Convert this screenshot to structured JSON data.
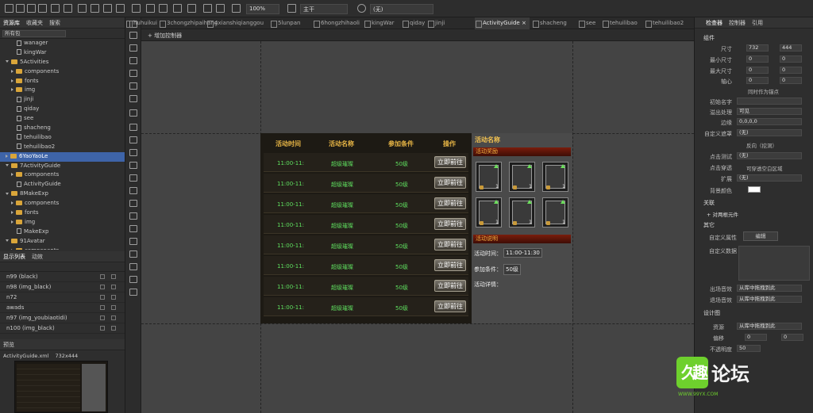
{
  "toolbar": {
    "zoom": "100%",
    "scene": "主干",
    "device": "(无)"
  },
  "left_panel": {
    "tabs": [
      "资源库",
      "收藏夹",
      "搜索"
    ],
    "filter": "所有包",
    "tree": [
      {
        "label": "wanager",
        "type": "file",
        "indent": 3
      },
      {
        "label": "kingWar",
        "type": "file",
        "indent": 3
      },
      {
        "label": "5Activities",
        "type": "folder",
        "indent": 1,
        "open": true
      },
      {
        "label": "components",
        "type": "folder",
        "indent": 2
      },
      {
        "label": "fonts",
        "type": "folder",
        "indent": 2
      },
      {
        "label": "img",
        "type": "folder",
        "indent": 2
      },
      {
        "label": "jinji",
        "type": "file",
        "indent": 3
      },
      {
        "label": "qiday",
        "type": "file",
        "indent": 3
      },
      {
        "label": "see",
        "type": "file",
        "indent": 3
      },
      {
        "label": "shacheng",
        "type": "file",
        "indent": 3
      },
      {
        "label": "tehuilibao",
        "type": "file",
        "indent": 3
      },
      {
        "label": "tehuilibao2",
        "type": "file",
        "indent": 3
      },
      {
        "label": "6YaoYaoLe",
        "type": "folder",
        "indent": 1,
        "selected": true
      },
      {
        "label": "7ActivityGuide",
        "type": "folder",
        "indent": 1,
        "open": true
      },
      {
        "label": "components",
        "type": "folder",
        "indent": 2
      },
      {
        "label": "ActivityGuide",
        "type": "file",
        "indent": 3
      },
      {
        "label": "8MakeExp",
        "type": "folder",
        "indent": 1,
        "open": true
      },
      {
        "label": "components",
        "type": "folder",
        "indent": 2
      },
      {
        "label": "fonts",
        "type": "folder",
        "indent": 2
      },
      {
        "label": "img",
        "type": "folder",
        "indent": 2
      },
      {
        "label": "MakeExp",
        "type": "file",
        "indent": 3
      },
      {
        "label": "91Avatar",
        "type": "folder",
        "indent": 1,
        "open": true
      },
      {
        "label": "components",
        "type": "folder",
        "indent": 2
      }
    ],
    "display_tabs": [
      "显示列表",
      "动效"
    ],
    "display_rows": [
      "n99 (black)",
      "n98 (img_black)",
      "n72",
      "awads",
      "n97 (img_youbiaotidi)",
      "n100 (img_black)"
    ],
    "preview_title": "预览",
    "preview_file": "ActivityGuide.xml",
    "preview_size": "732x444"
  },
  "tabs": [
    "huhuikui",
    "3chongzhipaihang",
    "4xianshiqianggou",
    "5lunpan",
    "6hongzhihaoli",
    "kingWar",
    "qiday",
    "jinji",
    "ActivityGuide",
    "shacheng",
    "see",
    "tehuilibao",
    "tehuilibao2"
  ],
  "active_tab": "ActivityGuide",
  "subbar": {
    "add_controller": "+ 增加控制器"
  },
  "stage": {
    "headers": [
      "活动时间",
      "活动名称",
      "参加条件",
      "操作"
    ],
    "rows": [
      {
        "time": "11:00-11:",
        "name": "超级璀璨",
        "cond": "50级",
        "btn": "立即前往"
      },
      {
        "time": "11:00-11:",
        "name": "超级璀璨",
        "cond": "50级",
        "btn": "立即前往"
      },
      {
        "time": "11:00-11:",
        "name": "超级璀璨",
        "cond": "50级",
        "btn": "立即前往"
      },
      {
        "time": "11:00-11:",
        "name": "超级璀璨",
        "cond": "50级",
        "btn": "立即前往"
      },
      {
        "time": "11:00-11:",
        "name": "超级璀璨",
        "cond": "50级",
        "btn": "立即前往"
      },
      {
        "time": "11:00-11:",
        "name": "超级璀璨",
        "cond": "50级",
        "btn": "立即前往"
      },
      {
        "time": "11:00-11:",
        "name": "超级璀璨",
        "cond": "50级",
        "btn": "立即前往"
      },
      {
        "time": "11:00-11:",
        "name": "超级璀璨",
        "cond": "50级",
        "btn": "立即前往"
      }
    ],
    "side_title": "活动名称",
    "reward_title": "活动奖励",
    "reward_counts": [
      "1",
      "1",
      "1",
      "1",
      "1",
      "1"
    ],
    "desc_title": "活动说明",
    "time_label": "活动时间：",
    "time_value": "11:00-11:30",
    "cond_label": "参加条件：",
    "cond_value": "50级",
    "detail_label": "活动详情："
  },
  "right_panel": {
    "tabs": [
      "检查器",
      "控制器",
      "引用"
    ],
    "sections": {
      "size": "组件",
      "relations": "关联",
      "other": "其它",
      "design": "设计图"
    },
    "size_label": "尺寸",
    "w": "732",
    "h": "444",
    "min_label": "最小尺寸",
    "min_w": "0",
    "min_h": "0",
    "max_label": "最大尺寸",
    "max_w": "0",
    "max_h": "0",
    "pivot_label": "轴心",
    "pivot_x": "0",
    "pivot_y": "0",
    "pivot_anchor": "同时作为锚点",
    "init_label": "初始名字",
    "overflow_label": "溢出处理",
    "overflow": "可见",
    "margin_label": "边缘",
    "margin": "0,0,0,0",
    "mask_label": "自定义遮罩",
    "mask": "(无)",
    "reverse": "反向（挖洞）",
    "hit_label": "点击测试",
    "hit": "(无)",
    "pass_label": "点击穿透",
    "pass": "可穿透空白区域",
    "extend_label": "扩展",
    "extend": "(无)",
    "bg_label": "背景颜色",
    "add_relation": "+ 对两根元件",
    "custom_attr_label": "自定义属性",
    "custom_attr_btn": "编辑",
    "custom_data_label": "自定义数据",
    "show_anim_label": "出场音效",
    "show_anim": "从库中拖拽到此",
    "hide_anim_label": "退场音效",
    "hide_anim": "从库中拖拽到此",
    "res_label": "资源",
    "res": "从库中拖拽到此",
    "offset_label": "偏移",
    "off_x": "0",
    "off_y": "0",
    "alpha_label": "不透明度",
    "alpha": "50"
  },
  "watermark": {
    "big": "久趣",
    "small": "论坛",
    "url": "WWW.99YX.COM"
  }
}
